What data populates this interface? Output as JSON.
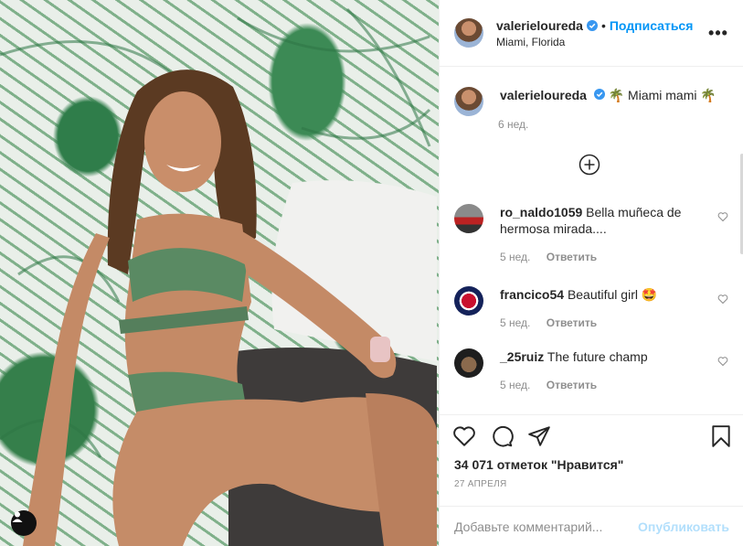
{
  "post": {
    "username": "valerieloureda",
    "follow_label": "Подписаться",
    "dot": "•",
    "location": "Miami, Florida",
    "more_label": "•••"
  },
  "caption": {
    "username": "valerieloureda",
    "text": "🌴 Miami mami 🌴",
    "time": "6 нед."
  },
  "comments": [
    {
      "username": "ro_naldo1059",
      "text": "Bella muñeca de hermosa mirada....",
      "time": "5 нед.",
      "reply": "Ответить"
    },
    {
      "username": "francico54",
      "text": "Beautiful girl 🤩",
      "time": "5 нед.",
      "reply": "Ответить"
    },
    {
      "username": "_25ruiz",
      "text": "The future champ",
      "time": "5 нед.",
      "reply": "Ответить"
    }
  ],
  "actions": {
    "likes": "34 071 отметок \"Нравится\"",
    "date": "27 апреля"
  },
  "add_comment": {
    "placeholder": "Добавьте комментарий...",
    "publish_label": "Опубликовать"
  },
  "icons": {
    "verified": "verified-badge-icon",
    "load_more": "plus-circle-icon",
    "like": "heart-icon",
    "comment": "comment-bubble-icon",
    "share": "paper-plane-icon",
    "save": "bookmark-icon",
    "user_tag": "user-tag-icon"
  },
  "colors": {
    "accent": "#0095f6",
    "verified": "#3897f0",
    "muted": "#8e8e8e",
    "publish_disabled": "#b2dffc"
  }
}
